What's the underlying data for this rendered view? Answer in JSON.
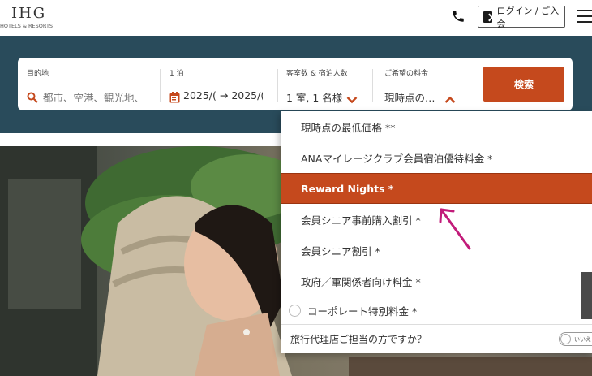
{
  "header": {
    "logo_main": "IHG",
    "logo_sub": "HOTELS & RESORTS",
    "login_label": "ログイン / ご入会"
  },
  "search": {
    "destination_label": "目的地",
    "destination_placeholder": "都市、空港、観光地、",
    "dates_label": "1 泊",
    "dates_value": "2025/( → 2025/(",
    "rooms_label": "客室数 & 宿泊人数",
    "rooms_value": "1 室, 1 名様",
    "rate_label": "ご希望の料金",
    "rate_value": "現時点の…",
    "search_button": "検索"
  },
  "rate_options": [
    {
      "label": "現時点の最低価格 **"
    },
    {
      "label": "ANAマイレージクラブ会員宿泊優待料金 *"
    },
    {
      "label": "Reward Nights *"
    },
    {
      "label": "会員シニア事前購入割引 *"
    },
    {
      "label": "会員シニア割引 *"
    },
    {
      "label": "政府／軍関係者向け料金 *"
    },
    {
      "label": "コーポレート特別料金 *"
    }
  ],
  "selected_index": 2,
  "agent": {
    "question": "旅行代理店ご担当の方ですか？",
    "toggle_label": "いいえ"
  },
  "colors": {
    "accent": "#c5491d",
    "banner": "#294b5b",
    "arrow": "#c21c7a"
  }
}
